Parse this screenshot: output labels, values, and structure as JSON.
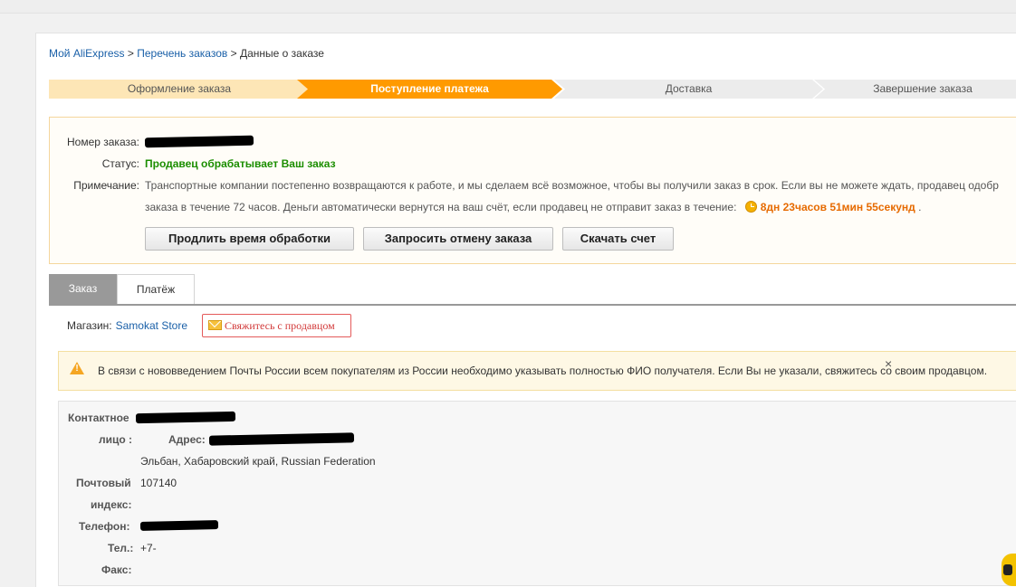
{
  "breadcrumb": {
    "home": "Мой AliExpress",
    "sep1": ">",
    "orders": "Перечень заказов",
    "sep2": ">",
    "current": "Данные о заказе"
  },
  "steps": [
    {
      "label": "Оформление заказа",
      "state": "done"
    },
    {
      "label": "Поступление платежа",
      "state": "current"
    },
    {
      "label": "Доставка",
      "state": "pending"
    },
    {
      "label": "Завершение заказа",
      "state": "pending"
    }
  ],
  "order": {
    "number_label": "Номер заказа:",
    "status_label": "Статус:",
    "status_value": "Продавец обрабатывает Ваш заказ",
    "note_label": "Примечание:",
    "note_line1": "Транспортные компании постепенно возвращаются к работе, и мы сделаем всё возможное, чтобы вы получили заказ в срок. Если вы не можете ждать, продавец одобр",
    "note_line2": "заказа в течение 72 часов. Деньги автоматически вернутся на ваш счёт, если продавец не отправит заказ в течение:",
    "timer": "8дн 23часов 51мин 55секунд",
    "timer_suffix": "."
  },
  "buttons": {
    "extend": "Продлить время обработки",
    "cancel": "Запросить отмену заказа",
    "invoice": "Скачать счет"
  },
  "tabs": [
    {
      "label": "Заказ",
      "active": true
    },
    {
      "label": "Платёж",
      "active": false
    }
  ],
  "shop": {
    "label": "Магазин:",
    "name": "Samokat Store",
    "contact": "Свяжитесь с продавцом"
  },
  "warning": {
    "text": "В связи с нововведением Почты России всем покупателям из России необходимо указывать полностью ФИО получателя. Если Вы не указали, свяжитесь со своим продавцом.",
    "close": "×"
  },
  "contact": {
    "person_label_1": "Контактное",
    "person_label_2": "лицо :",
    "address_label": "Адрес:",
    "address_line": "Эльбан, Хабаровский край, Russian Federation",
    "postal_label_1": "Почтовый",
    "postal_label_2": "индекс:",
    "postal_value": "107140",
    "phone_label": "Телефон:",
    "tel_label": "Тел.:",
    "tel_value": "+7-",
    "fax_label": "Факс:"
  },
  "colors": {
    "accent_orange": "#ff9a00",
    "status_green": "#1b8e00",
    "link_blue": "#1a60a8",
    "timer_orange": "#e66a00"
  }
}
